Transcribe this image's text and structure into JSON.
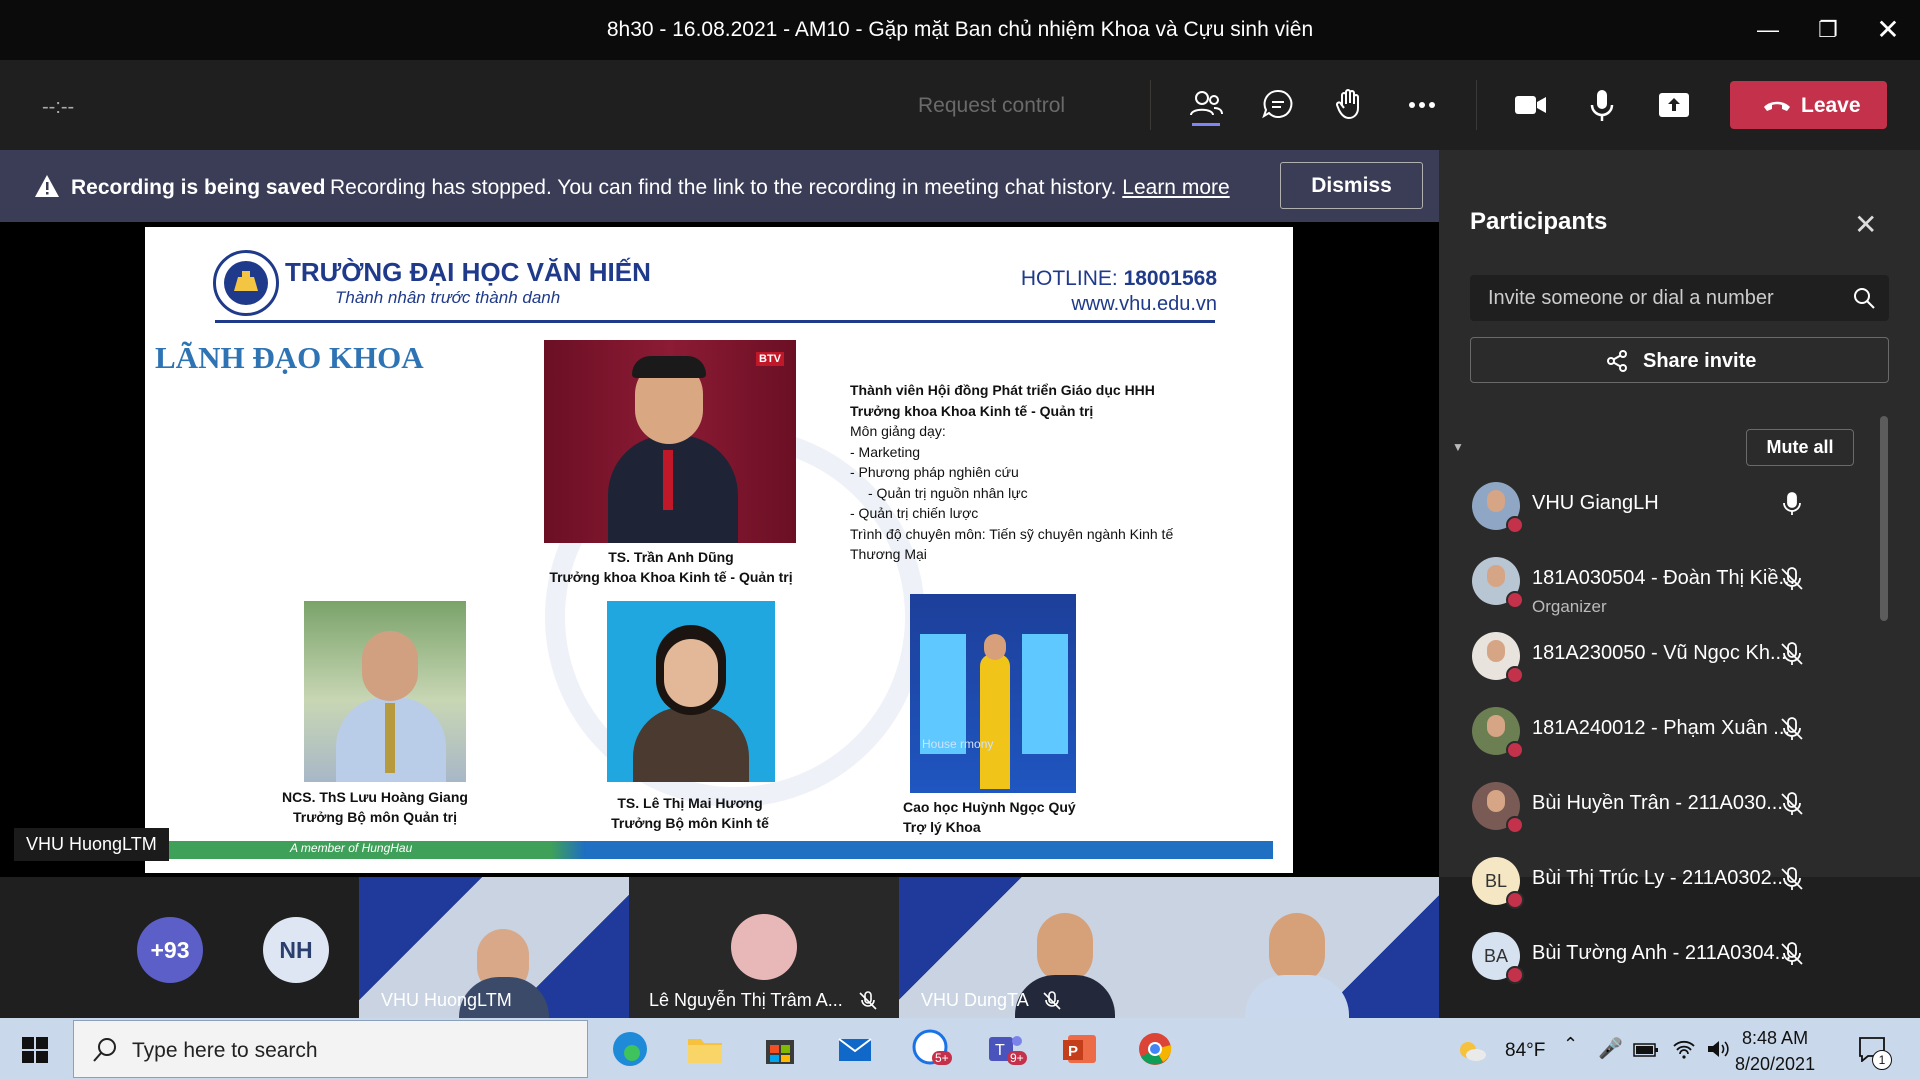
{
  "window": {
    "title": "8h30 - 16.08.2021 - AM10 - Gặp mặt Ban chủ nhiệm Khoa và Cựu sinh viên"
  },
  "toolbar": {
    "timer": "--:--",
    "request_control": "Request control",
    "leave": "Leave"
  },
  "banner": {
    "bold": "Recording is being saved",
    "message": "Recording has stopped. You can find the link to the recording in meeting chat history.",
    "link": "Learn more",
    "dismiss": "Dismiss"
  },
  "slide": {
    "school": "TRƯỜNG ĐẠI HỌC VĂN HIẾN",
    "slogan": "Thành nhân trước thành danh",
    "hotline_label": "HOTLINE:",
    "hotline": "18001568",
    "website": "www.vhu.edu.vn",
    "heading": "LÃNH ĐẠO KHOA",
    "photo_badge": "BTV",
    "dean": {
      "name": "TS. Trần Anh Dũng",
      "role": "Trưởng khoa Khoa Kinh tế - Quản trị"
    },
    "desc": [
      "Thành viên Hội đồng Phát triển Giáo dục HHH",
      "Trưởng khoa Khoa Kinh tế - Quản trị",
      "Môn giảng dạy:",
      "- Marketing",
      "- Phương pháp nghiên cứu",
      "    - Quản trị nguồn nhân lực",
      "- Quản trị chiến lược",
      "Trình độ chuyên môn: Tiến sỹ chuyên ngành Kinh tế",
      "Thương Mại"
    ],
    "p1": {
      "name": "NCS. ThS Lưu Hoàng Giang",
      "role": "Trưởng Bộ môn Quản trị"
    },
    "p2": {
      "name": "TS. Lê Thị Mai Hương",
      "role": "Trưởng Bộ môn Kinh tế"
    },
    "p3": {
      "name": "Cao học Huỳnh Ngọc Quý",
      "role": "Trợ lý Khoa"
    },
    "backdrop_text": "House   rmony",
    "footer": "A member of HungHau"
  },
  "stage": {
    "presenter": "VHU HuongLTM"
  },
  "panel": {
    "title": "Participants",
    "invite_placeholder": "Invite someone or dial a number",
    "share_invite": "Share invite",
    "mute_all": "Mute all",
    "participants": [
      {
        "name": "VHU GiangLH",
        "sub": "",
        "mic": "on",
        "avatar": "photo",
        "color": "#8fa7c4"
      },
      {
        "name": "181A030504 - Đoàn Thị Kiề...",
        "sub": "Organizer",
        "mic": "off",
        "avatar": "photo",
        "color": "#b8c6d4"
      },
      {
        "name": "181A230050 - Vũ Ngọc Kh...",
        "sub": "",
        "mic": "off",
        "avatar": "photo",
        "color": "#e8e3dc"
      },
      {
        "name": "181A240012 - Phạm Xuân ...",
        "sub": "",
        "mic": "off",
        "avatar": "photo",
        "color": "#6c7f52"
      },
      {
        "name": "Bùi Huyền Trân - 211A030...",
        "sub": "",
        "mic": "off",
        "avatar": "photo",
        "color": "#7a5a54"
      },
      {
        "name": "Bùi Thị Trúc Ly - 211A0302...",
        "sub": "",
        "mic": "off",
        "avatar": "BL",
        "color": "#f6e7c4"
      },
      {
        "name": "Bùi Tường Anh - 211A0304...",
        "sub": "",
        "mic": "off",
        "avatar": "BA",
        "color": "#d6e2f0"
      }
    ]
  },
  "gallery": {
    "overflow_count": "+93",
    "initials": "NH",
    "tiles": [
      {
        "label": "VHU HuongLTM",
        "muted": false
      },
      {
        "label": "Lê Nguyễn Thị Trâm A...",
        "muted": true
      },
      {
        "label": "VHU DungTA",
        "muted": true
      }
    ]
  },
  "taskbar": {
    "search_placeholder": "Type here to search",
    "zalo_badge": "5+",
    "teams_badge": "9+",
    "temperature": "84°F",
    "time": "8:48 AM",
    "date": "8/20/2021",
    "notification_count": "1"
  },
  "colors": {
    "accent": "#5b5fc7",
    "leave": "#c4314b",
    "banner": "#3b3d57",
    "panel": "#2b2b2b"
  }
}
